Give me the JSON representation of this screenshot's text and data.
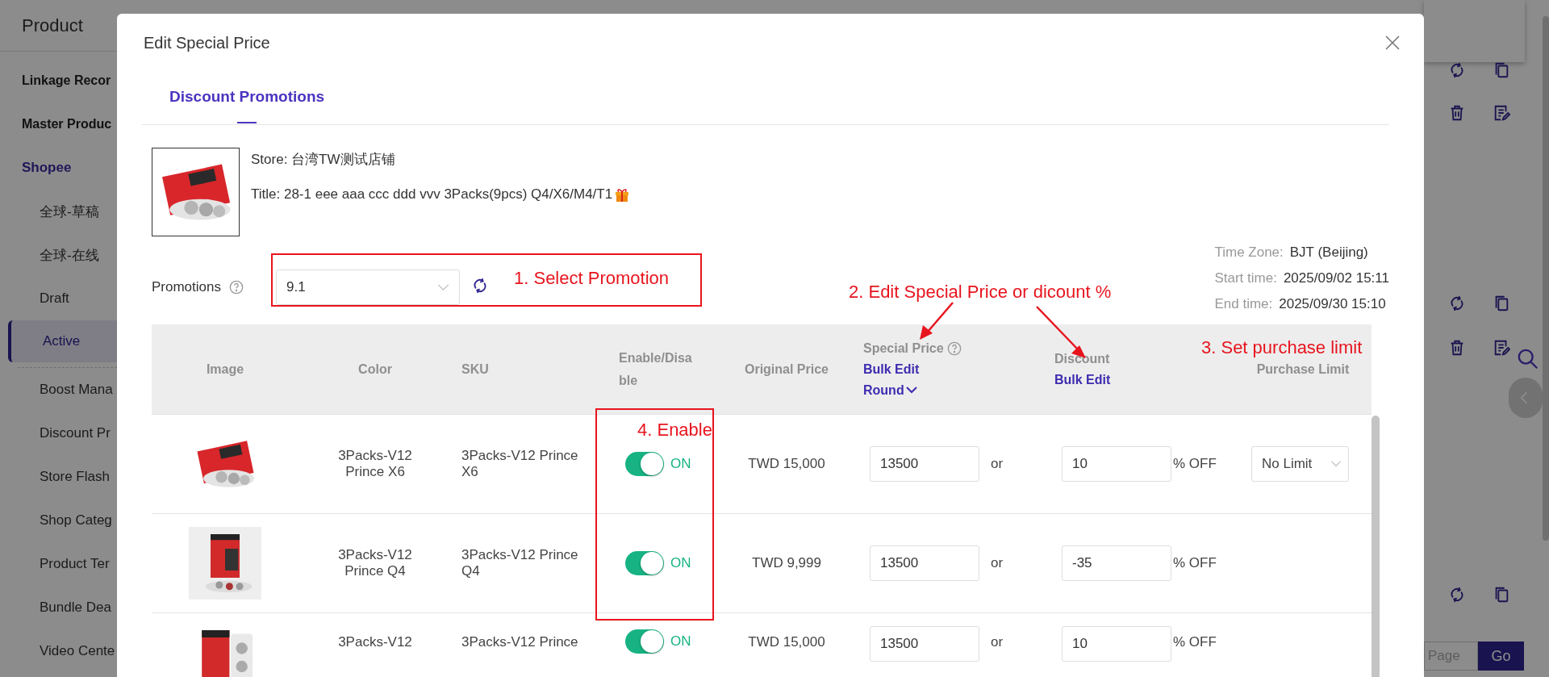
{
  "sidebar": {
    "header": "Product",
    "sections": [
      {
        "items": [
          {
            "label": "Linkage Recor",
            "kind": "group",
            "selected": false
          },
          {
            "label": "Master Produc",
            "kind": "group",
            "selected": false
          },
          {
            "label": "Shopee",
            "kind": "section",
            "selected": false
          },
          {
            "label": "全球-草稿",
            "kind": "sub",
            "selected": false
          },
          {
            "label": "全球-在线",
            "kind": "sub",
            "selected": false
          },
          {
            "label": "Draft",
            "kind": "sub",
            "selected": false
          },
          {
            "label": "Active",
            "kind": "sub",
            "selected": true
          }
        ]
      },
      {
        "items": [
          {
            "label": "Boost Mana",
            "kind": "sub",
            "selected": false
          },
          {
            "label": "Discount Pr",
            "kind": "sub",
            "selected": false
          },
          {
            "label": "Store Flash",
            "kind": "sub",
            "selected": false
          },
          {
            "label": "Shop Categ",
            "kind": "sub",
            "selected": false
          },
          {
            "label": "Product Ter",
            "kind": "sub",
            "selected": false
          },
          {
            "label": "Bundle Dea",
            "kind": "sub",
            "selected": false
          },
          {
            "label": "Video Cente",
            "kind": "sub",
            "selected": false
          }
        ]
      }
    ]
  },
  "pager": {
    "placeholder": "Page",
    "button": "Go"
  },
  "dialog": {
    "title": "Edit Special Price",
    "tabs": [
      {
        "label": "Discount Promotions",
        "selected": true
      }
    ],
    "product": {
      "store": "Store: 台湾TW测试店铺",
      "title": "Title: 28-1 eee aaa ccc ddd vvv 3Packs(9pcs) Q4/X6/M4/T1"
    },
    "promotions": {
      "label": "Promotions",
      "value": "9.1"
    },
    "schedule": [
      {
        "label": "Time Zone:",
        "value": "BJT (Beijing)"
      },
      {
        "label": "Start time:",
        "value": "2025/09/02 15:11"
      },
      {
        "label": "End time:",
        "value": "2025/09/30 15:10"
      }
    ],
    "table": {
      "columns": [
        {
          "label": "Image"
        },
        {
          "label": "Color"
        },
        {
          "label": "SKU"
        },
        {
          "label": "Enable/Disable"
        },
        {
          "label": "Original Price"
        },
        {
          "label": "Special Price",
          "help": true,
          "links": [
            {
              "label": "Bulk Edit",
              "kind": "link"
            },
            {
              "label": "Round",
              "kind": "dropdown"
            }
          ]
        },
        {
          "label": "Discount",
          "links": [
            {
              "label": "Bulk Edit",
              "kind": "link"
            }
          ]
        },
        {
          "label": "Purchase Limit"
        }
      ],
      "rows": [
        {
          "variant": "3Packs-V12 Prince X6",
          "sku": "3Packs-V12 Prince X6",
          "enabled": true,
          "switch_label": "ON",
          "original_price": "TWD 15,000",
          "special_price": "13500",
          "separator": "or",
          "discount": "10",
          "discount_suffix": "% OFF",
          "purchase_limit": "No Limit"
        },
        {
          "variant": "3Packs-V12 Prince Q4",
          "sku": "3Packs-V12 Prince Q4",
          "enabled": true,
          "switch_label": "ON",
          "original_price": "TWD 9,999",
          "special_price": "13500",
          "separator": "or",
          "discount": "-35",
          "discount_suffix": "% OFF"
        },
        {
          "variant": "3Packs-V12",
          "sku": "3Packs-V12 Prince",
          "enabled": true,
          "switch_label": "ON",
          "original_price": "TWD 15,000",
          "special_price": "13500",
          "separator": "or",
          "discount": "10",
          "discount_suffix": "% OFF"
        }
      ]
    }
  },
  "annotations": [
    {
      "text": "1. Select Promotion"
    },
    {
      "text": "2. Edit Special Price or dicount %"
    },
    {
      "text": "3. Set purchase limit"
    },
    {
      "text": "4. Enable"
    }
  ]
}
